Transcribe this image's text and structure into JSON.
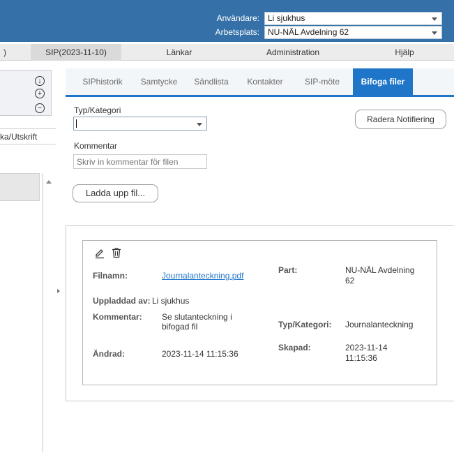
{
  "header": {
    "user_label": "Användare:",
    "user_value": "Li sjukhus",
    "workplace_label": "Arbetsplats:",
    "workplace_value": "NU-NÄL Avdelning 62",
    "bg_color": "#3571a8"
  },
  "menu": {
    "items": [
      ")",
      "SIP(2023-11-10)",
      "Länkar",
      "Administration",
      "Hjälp"
    ]
  },
  "left": {
    "tab_label": "ka/Utskrift"
  },
  "tabs": {
    "items": [
      "SIPhistorik",
      "Samtycke",
      "Sändlista",
      "Kontakter",
      "SIP-möte",
      "Bifoga filer"
    ],
    "active": "Bifoga filer",
    "accent": "#1f75c8"
  },
  "form": {
    "type_label": "Typ/Kategori",
    "type_value": "",
    "comment_label": "Kommentar",
    "comment_placeholder": "Skriv in kommentar för filen",
    "upload_button": "Ladda upp fil...",
    "clear_button": "Radera Notifiering"
  },
  "file": {
    "filename_label": "Filnamn:",
    "filename_value": "Journalanteckning.pdf",
    "uploaded_by_label": "Uppladdad av:",
    "uploaded_by_value": "Li sjukhus",
    "comment_label": "Kommentar:",
    "comment_value_line1": "Se slutanteckning i",
    "comment_value_line2": "bifogad fil",
    "changed_label": "Ändrad:",
    "changed_value": "2023-11-14 11:15:36",
    "part_label": "Part:",
    "part_value_line1": "NU-NÄL Avdelning",
    "part_value_line2": "62",
    "category_label": "Typ/Kategori:",
    "category_value": "Journalanteckning",
    "created_label": "Skapad:",
    "created_value_line1": "2023-11-14",
    "created_value_line2": "11:15:36"
  }
}
